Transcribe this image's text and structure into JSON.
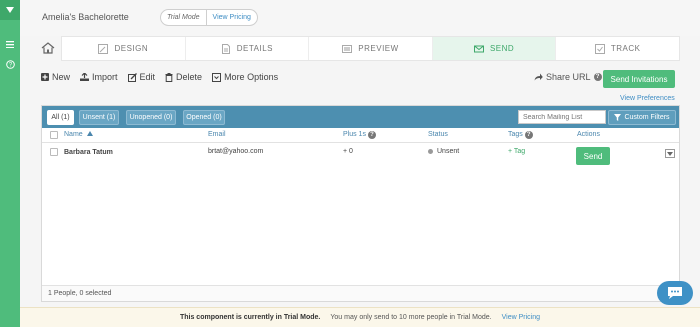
{
  "header": {
    "event_title": "Amelia's Bachelorette",
    "trial_mode": "Trial Mode",
    "view_pricing": "View Pricing"
  },
  "steps": [
    {
      "label": "DESIGN",
      "icon": "design-icon"
    },
    {
      "label": "DETAILS",
      "icon": "details-icon"
    },
    {
      "label": "PREVIEW",
      "icon": "preview-icon"
    },
    {
      "label": "SEND",
      "icon": "envelope-icon"
    },
    {
      "label": "TRACK",
      "icon": "track-icon"
    }
  ],
  "toolbar": {
    "new": "New",
    "import": "Import",
    "edit": "Edit",
    "delete": "Delete",
    "more_options": "More Options",
    "share_url": "Share URL",
    "send_invitations": "Send Invitations",
    "view_preferences": "View Preferences"
  },
  "filters": {
    "tabs": [
      "All (1)",
      "Unsent (1)",
      "Unopened (0)",
      "Opened (0)"
    ],
    "search_placeholder": "Search Mailing List",
    "custom_filters": "Custom Filters"
  },
  "columns": {
    "name": "Name",
    "email": "Email",
    "plus_ones": "Plus 1s",
    "status": "Status",
    "tags": "Tags",
    "actions": "Actions"
  },
  "rows": [
    {
      "name": "Barbara Tatum",
      "email": "brtat@yahoo.com",
      "plus_ones": "+ 0",
      "status": "Unsent",
      "tags": "+ Tag",
      "action": "Send"
    }
  ],
  "footer": {
    "summary": "1 People, 0 selected"
  },
  "notice": {
    "bold": "This component is currently in Trial Mode.",
    "text": "You may only send to 10 more people in Trial Mode.",
    "link": "View Pricing"
  },
  "colors": {
    "accent": "#4fbc7c",
    "filter_bar": "#4d8fb0",
    "link": "#3e8dc4"
  }
}
